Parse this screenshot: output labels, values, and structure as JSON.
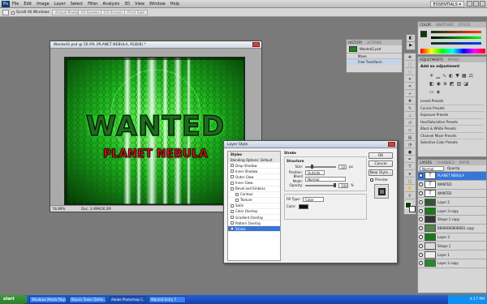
{
  "app": {
    "logo": "Ps",
    "menus": [
      "File",
      "Edit",
      "Image",
      "Layer",
      "Select",
      "Filter",
      "Analysis",
      "3D",
      "View",
      "Window",
      "Help"
    ],
    "workspace": "ESSENTIALS ▾"
  },
  "options_bar": {
    "scroll_all": "Scroll All Windows",
    "actual_pixels": "Actual Pixels",
    "fit_screen": "Fit Screen",
    "fill_screen": "Fill Screen",
    "print_size": "Print Size"
  },
  "document": {
    "title": "Wanted2.psd @ 56.9% (PLANET NEBULA, RGB/8) *",
    "zoom": "56.89%",
    "doc_size": "Doc: 3.49M/26.2M",
    "artwork_title": "WANTED",
    "artwork_subtitle": "PLANET NEBULA"
  },
  "history_panel": {
    "tabs": [
      "HISTORY",
      "ACTIONS"
    ],
    "items": [
      "Wanted2.psd",
      "Move",
      "Free Transform"
    ]
  },
  "color_panel": {
    "tabs": [
      "COLOR",
      "SWATCHES",
      "STYLES"
    ]
  },
  "adjustments_panel": {
    "tabs": [
      "ADJUSTMENTS",
      "MASKS"
    ],
    "heading": "Add an adjustment",
    "presets": [
      "Levels Presets",
      "Curves Presets",
      "Exposure Presets",
      "Hue/Saturation Presets",
      "Black & White Presets",
      "Channel Mixer Presets",
      "Selective Color Presets"
    ]
  },
  "dialog": {
    "title": "Layer Style",
    "styles_header": "Styles",
    "blending": "Blending Options: Default",
    "effects": [
      {
        "label": "Drop Shadow",
        "indent": false
      },
      {
        "label": "Inner Shadow",
        "indent": false
      },
      {
        "label": "Outer Glow",
        "indent": false
      },
      {
        "label": "Inner Glow",
        "indent": false
      },
      {
        "label": "Bevel and Emboss",
        "indent": false
      },
      {
        "label": "Contour",
        "indent": true
      },
      {
        "label": "Texture",
        "indent": true
      },
      {
        "label": "Satin",
        "indent": false
      },
      {
        "label": "Color Overlay",
        "indent": false
      },
      {
        "label": "Gradient Overlay",
        "indent": false
      },
      {
        "label": "Pattern Overlay",
        "indent": false
      }
    ],
    "selected_effect": "Stroke",
    "section_title": "Stroke",
    "structure_title": "Structure",
    "size_label": "Size:",
    "size_value": "10",
    "size_unit": "px",
    "position_label": "Position:",
    "position_value": "Outside",
    "blend_label": "Blend Mode:",
    "blend_value": "Normal",
    "opacity_label": "Opacity:",
    "opacity_value": "100",
    "opacity_unit": "%",
    "filltype_label": "Fill Type:",
    "filltype_value": "Color",
    "color_label": "Color:",
    "ok": "OK",
    "cancel": "Cancel",
    "new_style": "New Style...",
    "preview": "Preview"
  },
  "layers_panel": {
    "tabs": [
      "LAYERS",
      "CHANNELS",
      "PATHS"
    ],
    "blend_mode": "Normal",
    "opacity_label": "Opacity:",
    "layers": [
      {
        "name": "PLANET NEBULA",
        "thumb": "T",
        "selected": true
      },
      {
        "name": "WANTED",
        "thumb": "T",
        "selected": false
      },
      {
        "name": "WANTED",
        "thumb": "T",
        "selected": false
      },
      {
        "name": "Layer 2",
        "thumb": "",
        "selected": false
      },
      {
        "name": "Layer 3 copy",
        "thumb": "",
        "selected": false
      },
      {
        "name": "Shape 1 copy",
        "thumb": "",
        "selected": false
      },
      {
        "name": "BB0B0B0B0B0B1 copy",
        "thumb": "",
        "selected": false
      },
      {
        "name": "Layer 3",
        "thumb": "",
        "selected": false
      },
      {
        "name": "Shape 1",
        "thumb": "",
        "selected": false
      },
      {
        "name": "Layer 1",
        "thumb": "",
        "selected": false
      },
      {
        "name": "Layer 2 copy",
        "thumb": "",
        "selected": false
      }
    ]
  },
  "taskbar": {
    "start": "start",
    "items": [
      "Windows Media Player",
      "Bloons Tower Defen...",
      "Adobe Photoshop C...",
      "Wanted Entry 7"
    ],
    "clock": "4:17 PM"
  },
  "colors": {
    "accent": "#3875d7",
    "neon": "#33ff33",
    "red": "#e01818"
  }
}
